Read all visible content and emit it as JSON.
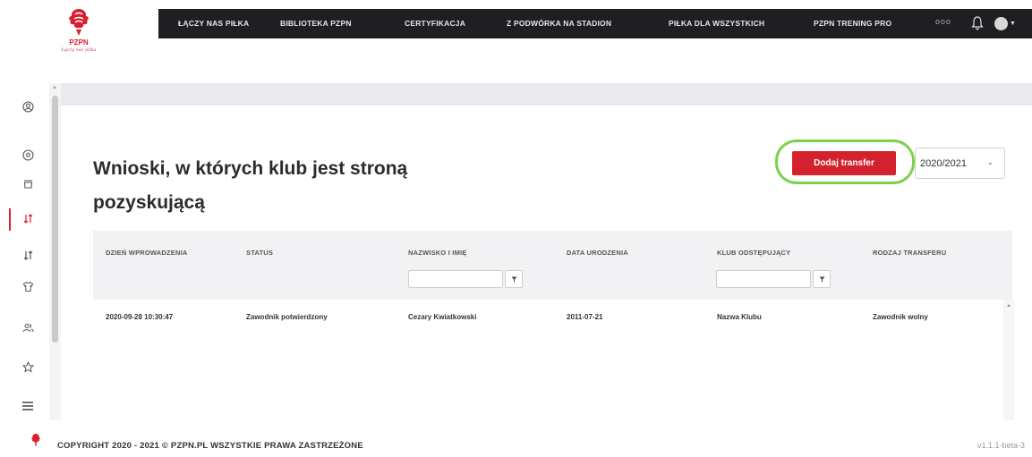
{
  "brand": {
    "name": "PZPN",
    "tagline": "Łączy nas piłka",
    "color": "#d71f2e"
  },
  "topnav": {
    "items": [
      "ŁĄCZY NAS PIŁKA",
      "BIBLIOTEKA PZPN",
      "CERTYFIKACJA",
      "Z PODWÓRKA NA STADION",
      "PIŁKA DLA WSZYSTKICH",
      "PZPN TRENING PRO"
    ],
    "more": "ooo"
  },
  "sidebar": {
    "icons": [
      "user-circle-icon",
      "football-icon",
      "cup-icon",
      "transfer-arrows-icon",
      "transfer-arrows-icon",
      "shirt-icon",
      "users-icon",
      "star-icon",
      "menu-icon"
    ],
    "active_index": 3
  },
  "page": {
    "title": "Wnioski, w których klub jest stroną pozyskującą",
    "add_button": "Dodaj transfer",
    "season": "2020/2021"
  },
  "table": {
    "headers": [
      "DZIEŃ WPROWADZENIA",
      "STATUS",
      "NAZWISKO I IMIĘ",
      "DATA URODZENIA",
      "KLUB ODSTĘPUJĄCY",
      "RODZAJ TRANSFERU"
    ],
    "rows": [
      [
        "2020-09-28 10:30:47",
        "Zawodnik potwierdzony",
        "Cezary Kwiatkowski",
        "2011-07-21",
        "Nazwa Klubu",
        "Zawodnik wolny"
      ]
    ],
    "filter_icon": "filter-icon"
  },
  "footer": {
    "copyright": "COPYRIGHT 2020 - 2021 © PZPN.PL WSZYSTKIE PRAWA ZASTRZEŻONE",
    "version": "v1.1.1-beta-3"
  },
  "colors": {
    "accent": "#d3212e",
    "highlight": "#7bd24a",
    "nav_bg": "#1f1f23"
  }
}
